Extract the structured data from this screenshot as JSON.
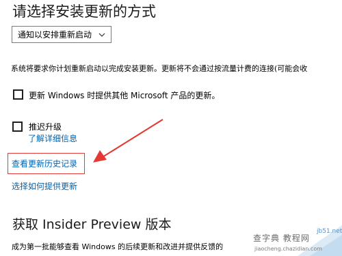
{
  "header": {
    "title": "请选择安装更新的方式"
  },
  "install_mode": {
    "selected": "通知以安排重新启动"
  },
  "description": "系统将要求你计划重新启动以完成安装更新。更新将不会通过按流量计费的连接(可能会收",
  "options": [
    {
      "label": "更新 Windows 时提供其他 Microsoft 产品的更新。",
      "checked": false
    },
    {
      "label": "推迟升级",
      "checked": false
    }
  ],
  "links": {
    "details": "了解详细信息",
    "history": "查看更新历史记录",
    "feedback": "选择如何提供更新"
  },
  "insider": {
    "title": "获取 Insider Preview 版本",
    "description": "成为第一批能够查看 Windows 的后续更新和改进并提供反馈的"
  },
  "watermark": {
    "site": "jb51.net",
    "name": "查字典 教程网",
    "url": "jiaocheng.chazidian.com"
  },
  "colors": {
    "link": "#0063b1",
    "highlight": "#e53935"
  }
}
